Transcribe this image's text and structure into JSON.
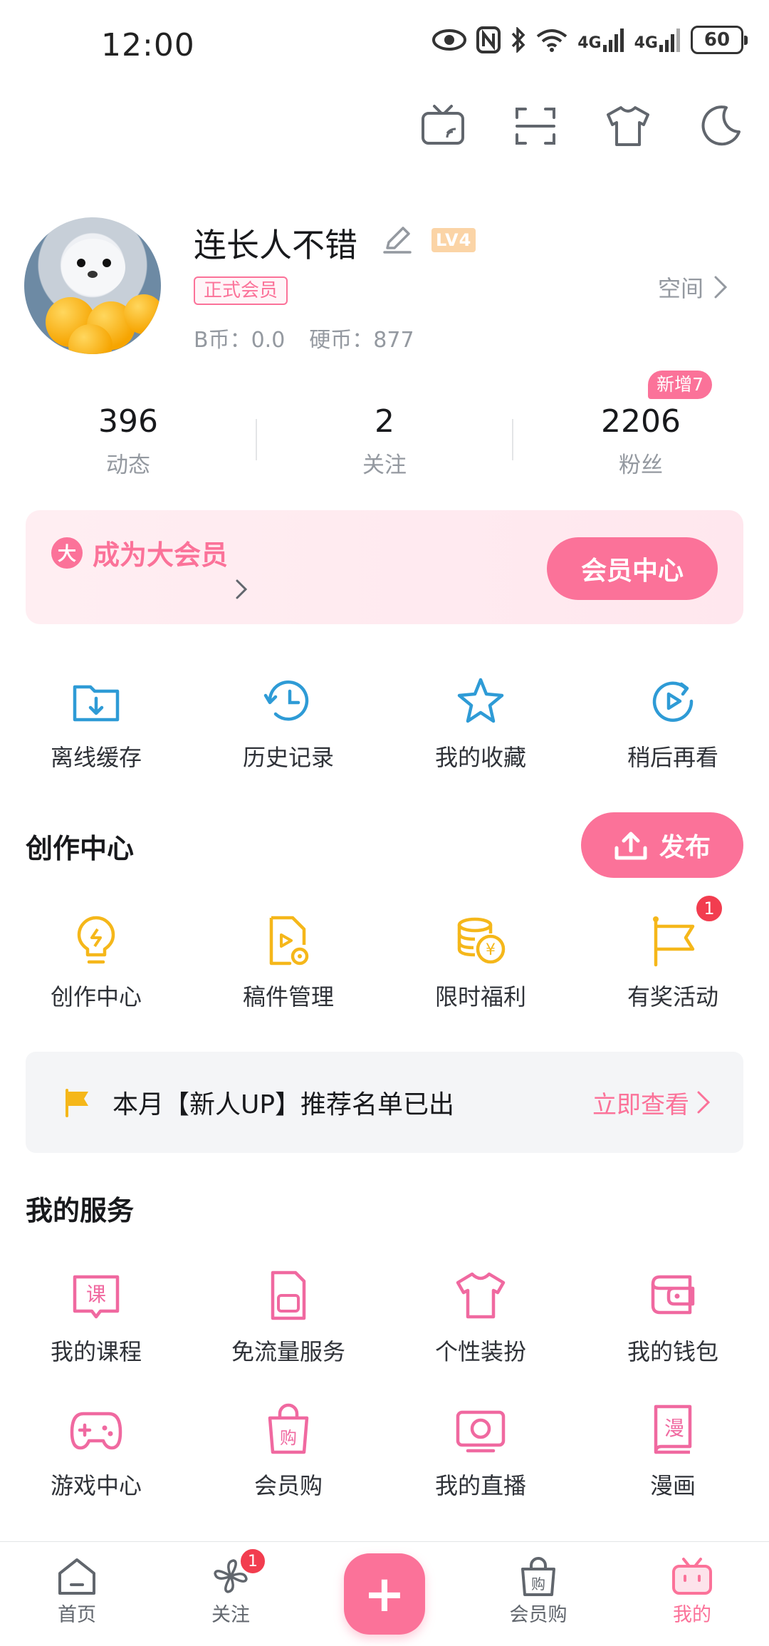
{
  "status_bar": {
    "time": "12:00",
    "network_label_1": "4G",
    "network_label_2": "4G",
    "battery": "60"
  },
  "top_tools": [
    "tv-cast-icon",
    "scan-icon",
    "outfit-icon",
    "night-mode-icon"
  ],
  "profile": {
    "username": "连长人不错",
    "level": "LV4",
    "vip_badge": "正式会员",
    "space_link": "空间",
    "b_coin": "B币：0.0",
    "hard_coin": "硬币：877"
  },
  "stats": {
    "new_badge": "新增7",
    "items": [
      {
        "value": "396",
        "label": "动态"
      },
      {
        "value": "2",
        "label": "关注"
      },
      {
        "value": "2206",
        "label": "粉丝"
      }
    ]
  },
  "vip_banner": {
    "icon_char": "大",
    "title": "成为大会员",
    "button": "会员中心"
  },
  "quick_actions": [
    {
      "label": "离线缓存",
      "icon": "offline-cache-icon"
    },
    {
      "label": "历史记录",
      "icon": "history-icon"
    },
    {
      "label": "我的收藏",
      "icon": "star-icon"
    },
    {
      "label": "稍后再看",
      "icon": "watch-later-icon"
    }
  ],
  "creation": {
    "title": "创作中心",
    "publish_button": "发布",
    "items": [
      {
        "label": "创作中心",
        "icon": "lightbulb-icon"
      },
      {
        "label": "稿件管理",
        "icon": "manuscript-icon"
      },
      {
        "label": "限时福利",
        "icon": "coins-icon"
      },
      {
        "label": "有奖活动",
        "icon": "flag-icon",
        "badge": "1"
      }
    ]
  },
  "notice": {
    "text": "本月【新人UP】推荐名单已出",
    "link": "立即查看"
  },
  "services": {
    "title": "我的服务",
    "items": [
      {
        "label": "我的课程",
        "icon": "course-icon",
        "glyph": "课"
      },
      {
        "label": "免流量服务",
        "icon": "sim-card-icon"
      },
      {
        "label": "个性装扮",
        "icon": "tshirt-icon"
      },
      {
        "label": "我的钱包",
        "icon": "wallet-icon"
      },
      {
        "label": "游戏中心",
        "icon": "gamepad-icon"
      },
      {
        "label": "会员购",
        "icon": "shopping-bag-icon",
        "glyph": "购"
      },
      {
        "label": "我的直播",
        "icon": "live-tv-icon"
      },
      {
        "label": "漫画",
        "icon": "comic-icon",
        "glyph": "漫"
      }
    ]
  },
  "bottom_nav": {
    "items": [
      {
        "label": "首页",
        "icon": "home-icon"
      },
      {
        "label": "关注",
        "icon": "pinwheel-icon",
        "badge": "1"
      },
      {
        "label": "",
        "icon": "plus-icon",
        "glyph": "+"
      },
      {
        "label": "会员购",
        "icon": "shopping-bag-icon",
        "glyph": "购"
      },
      {
        "label": "我的",
        "icon": "tv-face-icon"
      }
    ]
  },
  "colors": {
    "brand_pink": "#fb7299",
    "service_blue": "#2e9bd6",
    "creation_yellow": "#f5b71a",
    "badge_red": "#f23d4f"
  }
}
